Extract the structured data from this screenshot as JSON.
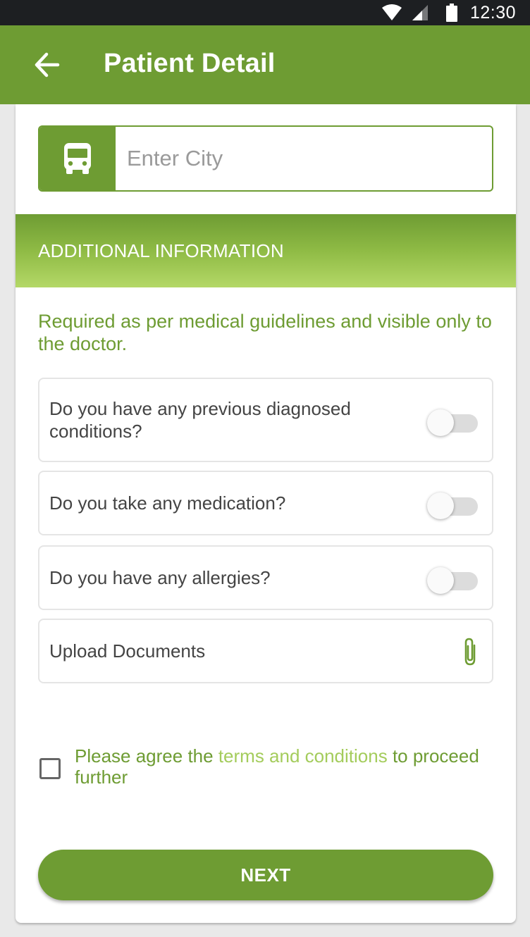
{
  "status_bar": {
    "time": "12:30",
    "icons": [
      "wifi-icon",
      "signal-icon",
      "battery-icon"
    ]
  },
  "app_bar": {
    "title": "Patient Detail",
    "back_icon": "arrow-left-icon"
  },
  "city": {
    "icon": "bus-icon",
    "placeholder": "Enter City",
    "value": ""
  },
  "additional": {
    "header": "ADDITIONAL INFORMATION",
    "note": "Required as per medical guidelines and visible only to the doctor.",
    "questions": [
      {
        "label": "Do you have any previous diagnosed conditions?",
        "enabled": false
      },
      {
        "label": "Do you take any medication?",
        "enabled": false
      },
      {
        "label": "Do you have any allergies?",
        "enabled": false
      }
    ],
    "upload": {
      "label": "Upload Documents",
      "icon": "paperclip-icon"
    }
  },
  "agree": {
    "prefix": "Please agree the ",
    "link": "terms and conditions",
    "suffix": " to proceed further",
    "checked": false
  },
  "next_label": "NEXT",
  "colors": {
    "primary": "#6e9c33",
    "accent_light": "#a4cc5c",
    "status_bar": "#1d1f22"
  }
}
